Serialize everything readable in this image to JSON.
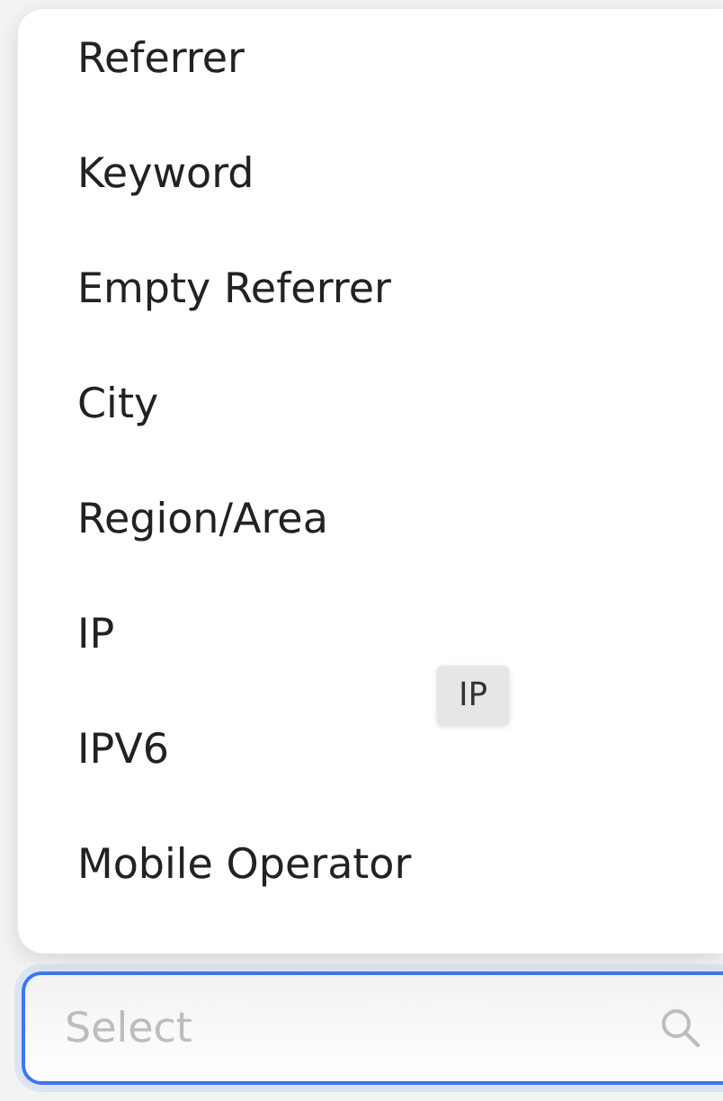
{
  "menu": {
    "items": [
      {
        "label": "Referrer"
      },
      {
        "label": "Keyword"
      },
      {
        "label": "Empty Referrer"
      },
      {
        "label": "City"
      },
      {
        "label": "Region/Area"
      },
      {
        "label": "IP"
      },
      {
        "label": "IPV6"
      },
      {
        "label": "Mobile Operator"
      }
    ]
  },
  "tooltip": {
    "text": "IP"
  },
  "search": {
    "placeholder": "Select",
    "focused": true
  }
}
